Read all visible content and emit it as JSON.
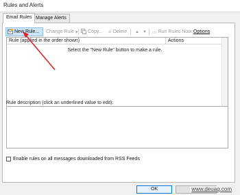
{
  "window": {
    "title": "Rules and Alerts"
  },
  "tabs": [
    {
      "label": "Email Rules",
      "active": true
    },
    {
      "label": "Manage Alerts",
      "active": false
    }
  ],
  "toolbar": {
    "new_rule": "New Rule...",
    "change_rule": "Change Rule",
    "copy": "Copy...",
    "delete": "Delete",
    "move_up": "▲",
    "move_down": "▼",
    "run_rules_now": "Run Rules Now...",
    "options": "Options"
  },
  "rules_table": {
    "columns": [
      "Rule (applied in the order shown)",
      "Actions"
    ],
    "empty_message": "Select the \"New Rule\" button to make a rule."
  },
  "rule_description": {
    "label": "Rule description (click an underlined value to edit):"
  },
  "rss_checkbox": {
    "label": "Enable rules on all messages downloaded from RSS Feeds",
    "checked": false
  },
  "buttons": {
    "ok": "OK"
  },
  "watermark": "www.deuaq.com",
  "colors": {
    "accent": "#0078d7",
    "selection": "#cde4f7",
    "annotation_arrow": "#d8232a"
  }
}
